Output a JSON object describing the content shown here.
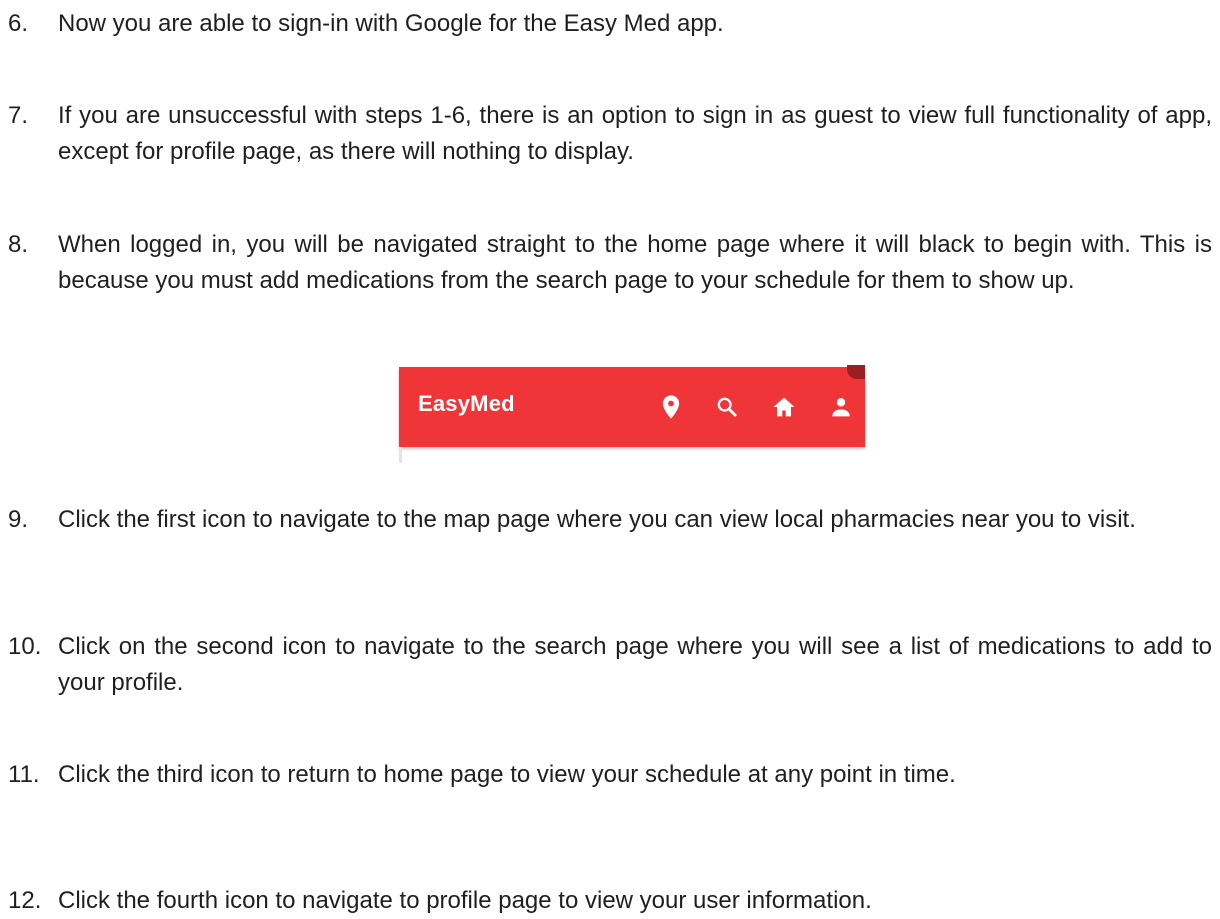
{
  "steps": [
    {
      "num": "6.",
      "text": "Now you are able to sign-in with Google for the Easy Med app."
    },
    {
      "num": "7.",
      "text": "If you are unsuccessful with steps 1-6, there is an option to sign in as guest to view full functionality of app, except for profile page, as there will nothing to display."
    },
    {
      "num": "8.",
      "text": "When logged in, you will be navigated straight to the home page where it will black to begin with. This is because you must add medications from the search page to your schedule for them to show up."
    },
    {
      "num": "9.",
      "text": "Click the first icon to navigate to the map page where you can view local pharmacies near you to visit."
    },
    {
      "num": "10.",
      "text": "Click on the second icon to navigate to the search page where you will see a list of medications to add to your profile."
    },
    {
      "num": "11.",
      "text": "Click the third icon to return to home page to view your schedule at any point in time."
    },
    {
      "num": "12.",
      "text": "Click the fourth icon to navigate to profile page to view your user information."
    }
  ],
  "app_bar": {
    "title": "EasyMed",
    "background_color": "#f03539",
    "icons": [
      "map-marker-icon",
      "search-icon",
      "home-icon",
      "person-icon"
    ]
  }
}
